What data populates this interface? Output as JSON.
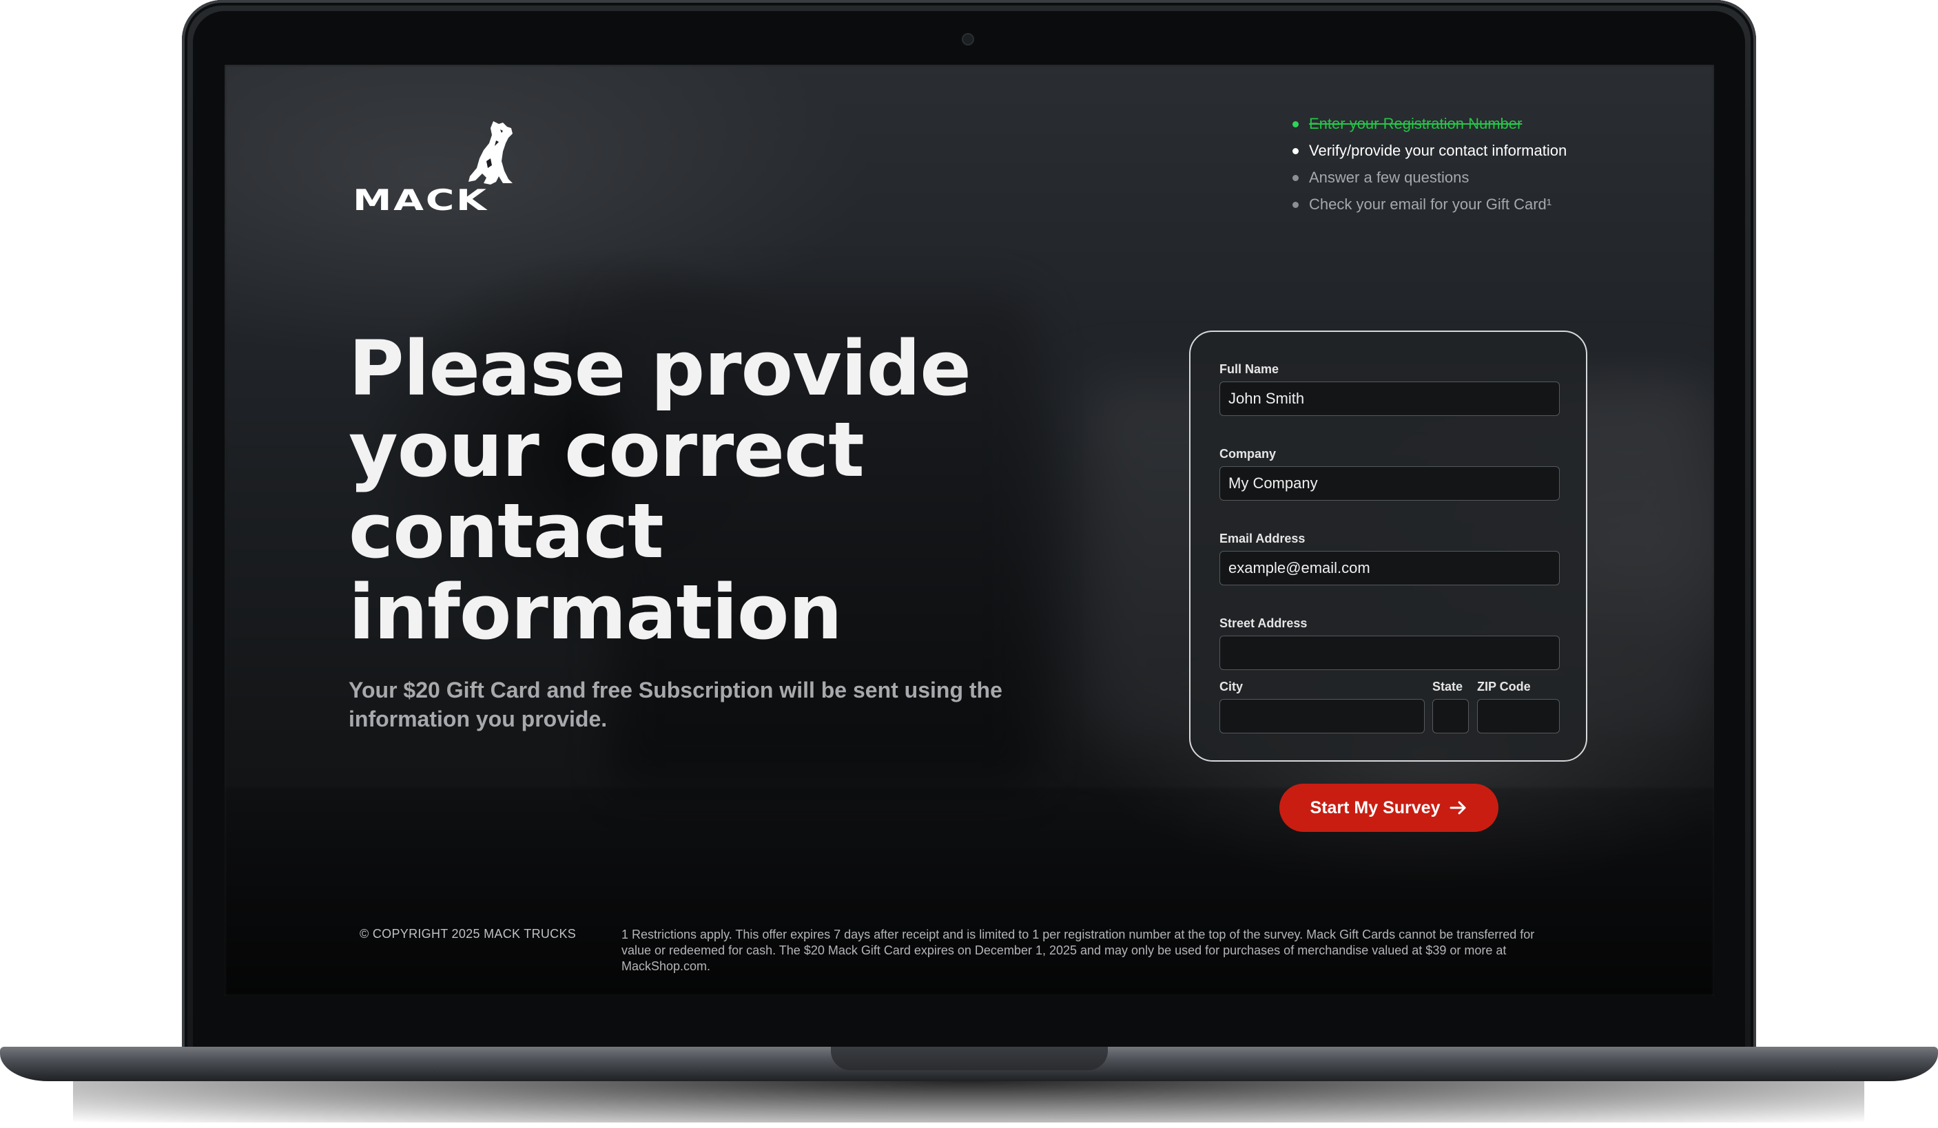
{
  "brand": {
    "name": "MACK",
    "accent_color": "#c91d12"
  },
  "progress_steps": [
    {
      "label": "Enter your Registration Number",
      "status": "completed"
    },
    {
      "label": "Verify/provide your contact information",
      "status": "current"
    },
    {
      "label": "Answer a few questions",
      "status": "pending"
    },
    {
      "label": "Check your email for your Gift Card¹",
      "status": "pending"
    }
  ],
  "hero": {
    "title": "Please provide your correct contact information",
    "subtitle": "Your $20 Gift Card and free Subscription will be sent using the information you provide."
  },
  "form": {
    "full_name": {
      "label": "Full Name",
      "value": "John Smith"
    },
    "company": {
      "label": "Company",
      "value": "My Company"
    },
    "email": {
      "label": "Email Address",
      "value": "example@email.com"
    },
    "street": {
      "label": "Street Address",
      "value": ""
    },
    "city": {
      "label": "City",
      "value": ""
    },
    "state": {
      "label": "State",
      "value": ""
    },
    "zip": {
      "label": "ZIP Code",
      "value": ""
    }
  },
  "cta": {
    "label": "Start My Survey",
    "icon": "arrow-right-icon"
  },
  "footer": {
    "copyright": "© COPYRIGHT 2025 MACK TRUCKS",
    "disclaimer": "1 Restrictions apply. This offer expires 7 days after receipt and is limited to 1 per registration number at the top of the survey. Mack Gift Cards cannot be transferred for value or redeemed for cash. The $20 Mack Gift Card expires on December 1, 2025 and may only be used for purchases of merchandise valued at $39 or more at MackShop.com."
  }
}
